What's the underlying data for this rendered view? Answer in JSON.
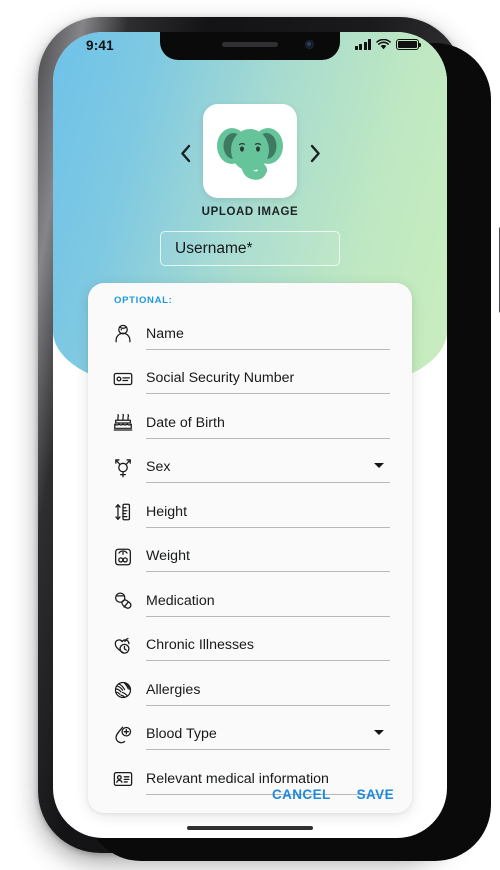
{
  "device": {
    "frame": "iphone-x",
    "status_bar": {
      "time": "9:41",
      "cellular_icon": "signal-bars-icon",
      "wifi_icon": "wifi-icon",
      "battery_icon": "battery-full-icon"
    }
  },
  "theme": {
    "gradient_start": "#6ec2e9",
    "gradient_end": "#c9edbe",
    "accent_blue": "#1d88e0",
    "optional_label_color": "#1c9ae0",
    "avatar_body": "#66c49a",
    "avatar_ear_inner": "#3e7a62",
    "card_background": "#fafafa",
    "underline_color": "#b9b9b9"
  },
  "avatar": {
    "image_name": "elephant-avatar",
    "prev_icon": "chevron-left-icon",
    "next_icon": "chevron-right-icon",
    "upload_label": "UPLOAD IMAGE"
  },
  "username": {
    "value": "",
    "placeholder": "Username*"
  },
  "optional_section": {
    "heading": "OPTIONAL:",
    "fields": [
      {
        "label": "Name",
        "icon": "person-id-icon",
        "type": "text",
        "value": ""
      },
      {
        "label": "Social Security Number",
        "icon": "id-card-icon",
        "type": "text",
        "value": ""
      },
      {
        "label": "Date of Birth",
        "icon": "birthday-cake-icon",
        "type": "text",
        "value": ""
      },
      {
        "label": "Sex",
        "icon": "gender-symbol-icon",
        "type": "select",
        "value": ""
      },
      {
        "label": "Height",
        "icon": "ruler-height-icon",
        "type": "text",
        "value": ""
      },
      {
        "label": "Weight",
        "icon": "weight-scale-icon",
        "type": "text",
        "value": ""
      },
      {
        "label": "Medication",
        "icon": "pills-icon",
        "type": "text",
        "value": ""
      },
      {
        "label": "Chronic Illnesses",
        "icon": "heart-clock-icon",
        "type": "text",
        "value": ""
      },
      {
        "label": "Allergies",
        "icon": "peanut-allergy-icon",
        "type": "text",
        "value": ""
      },
      {
        "label": "Blood Type",
        "icon": "blood-drop-plus-icon",
        "type": "select",
        "value": ""
      },
      {
        "label": "Relevant medical information",
        "icon": "medical-id-card-icon",
        "type": "text",
        "value": ""
      }
    ],
    "actions": {
      "cancel_label": "CANCEL",
      "save_label": "SAVE"
    }
  }
}
